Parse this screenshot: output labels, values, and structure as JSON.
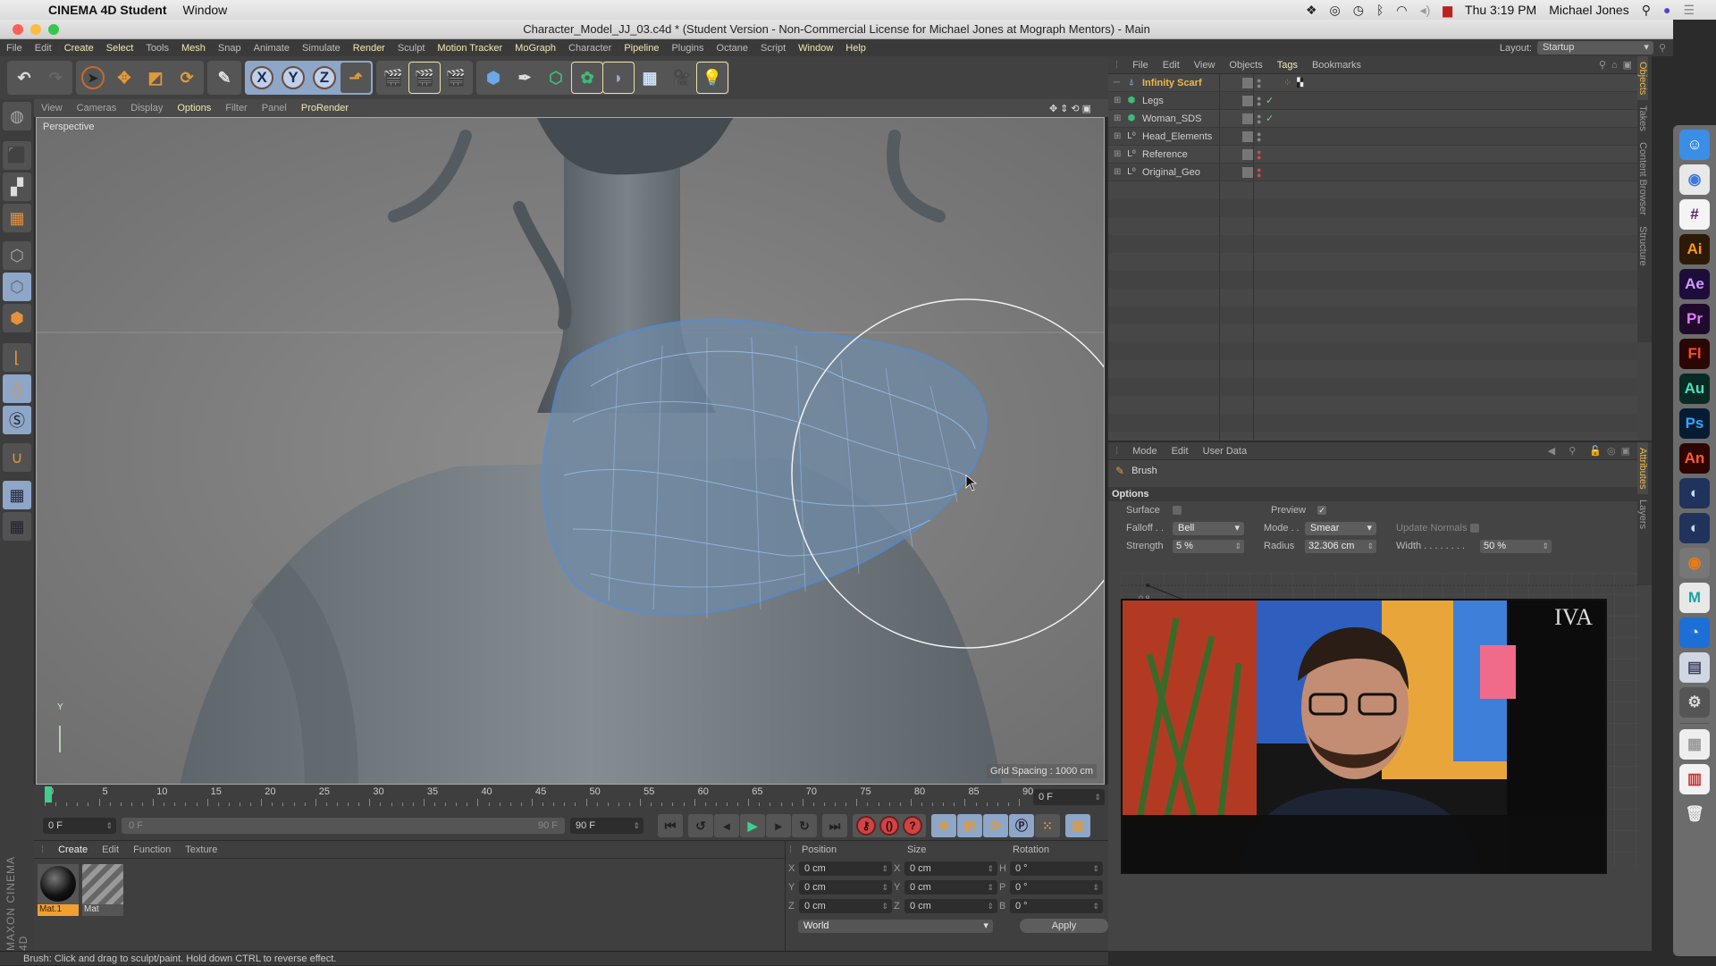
{
  "mac_menubar": {
    "app_name": "CINEMA 4D Student",
    "menu_window": "Window",
    "status_icons": [
      "dropbox-icon",
      "creative-cloud-icon",
      "time-machine-icon",
      "bluetooth-icon",
      "wifi-icon",
      "volume-icon",
      "flag-icon"
    ],
    "clock": "Thu 3:19 PM",
    "user": "Michael Jones"
  },
  "window": {
    "title": "Character_Model_JJ_03.c4d * (Student Version - Non-Commercial License for Michael Jones at Mograph Mentors) - Main"
  },
  "app_menu": {
    "items": [
      {
        "label": "File",
        "highlight": false
      },
      {
        "label": "Edit",
        "highlight": false
      },
      {
        "label": "Create",
        "highlight": true
      },
      {
        "label": "Select",
        "highlight": true
      },
      {
        "label": "Tools",
        "highlight": false
      },
      {
        "label": "Mesh",
        "highlight": true
      },
      {
        "label": "Snap",
        "highlight": false
      },
      {
        "label": "Animate",
        "highlight": false
      },
      {
        "label": "Simulate",
        "highlight": false
      },
      {
        "label": "Render",
        "highlight": true
      },
      {
        "label": "Sculpt",
        "highlight": false
      },
      {
        "label": "Motion Tracker",
        "highlight": true
      },
      {
        "label": "MoGraph",
        "highlight": true
      },
      {
        "label": "Character",
        "highlight": false
      },
      {
        "label": "Pipeline",
        "highlight": true
      },
      {
        "label": "Plugins",
        "highlight": false
      },
      {
        "label": "Octane",
        "highlight": false
      },
      {
        "label": "Script",
        "highlight": false
      },
      {
        "label": "Window",
        "highlight": true
      },
      {
        "label": "Help",
        "highlight": true
      }
    ],
    "layout_label": "Layout:",
    "layout_value": "Startup"
  },
  "toolbar": {
    "axis_x": "X",
    "axis_y": "Y",
    "axis_z": "Z"
  },
  "viewport": {
    "menu": [
      {
        "label": "View",
        "highlight": false
      },
      {
        "label": "Cameras",
        "highlight": false
      },
      {
        "label": "Display",
        "highlight": false
      },
      {
        "label": "Options",
        "highlight": true
      },
      {
        "label": "Filter",
        "highlight": false
      },
      {
        "label": "Panel",
        "highlight": false
      },
      {
        "label": "ProRender",
        "highlight": true
      }
    ],
    "camera_label": "Perspective",
    "grid_spacing": "Grid Spacing : 1000 cm",
    "axis_y": "Y"
  },
  "timeline": {
    "ticks": [
      "0",
      "5",
      "10",
      "15",
      "20",
      "25",
      "30",
      "35",
      "40",
      "45",
      "50",
      "55",
      "60",
      "65",
      "70",
      "75",
      "80",
      "85",
      "90"
    ],
    "current_frame_field": "0 F",
    "start_field": "0 F",
    "range_start": "0 F",
    "range_end": "90 F",
    "end_field": "90 F"
  },
  "material_manager": {
    "menu": [
      {
        "label": "Create",
        "highlight": true
      },
      {
        "label": "Edit",
        "highlight": false
      },
      {
        "label": "Function",
        "highlight": false
      },
      {
        "label": "Texture",
        "highlight": false
      }
    ],
    "materials": [
      {
        "name": "Mat.1",
        "selected": true
      },
      {
        "name": "Mat",
        "selected": false
      }
    ],
    "brand": "MAXON CINEMA 4D"
  },
  "coordinates": {
    "headers": {
      "position": "Position",
      "size": "Size",
      "rotation": "Rotation"
    },
    "rows": [
      {
        "p_axis": "X",
        "p_val": "0 cm",
        "s_axis": "X",
        "s_val": "0 cm",
        "r_axis": "H",
        "r_val": "0 °"
      },
      {
        "p_axis": "Y",
        "p_val": "0 cm",
        "s_axis": "Y",
        "s_val": "0 cm",
        "r_axis": "P",
        "r_val": "0 °"
      },
      {
        "p_axis": "Z",
        "p_val": "0 cm",
        "s_axis": "Z",
        "s_val": "0 cm",
        "r_axis": "B",
        "r_val": "0 °"
      }
    ],
    "space": "World",
    "apply": "Apply"
  },
  "status_bar": "Brush: Click and drag to sculpt/paint. Hold down CTRL to reverse effect.",
  "object_manager": {
    "menu": [
      {
        "label": "File",
        "highlight": false
      },
      {
        "label": "Edit",
        "highlight": false
      },
      {
        "label": "View",
        "highlight": false
      },
      {
        "label": "Objects",
        "highlight": false
      },
      {
        "label": "Tags",
        "highlight": true
      },
      {
        "label": "Bookmarks",
        "highlight": false
      }
    ],
    "objects": [
      {
        "name": "Infinity Scarf",
        "icon": "sculpt-icon",
        "expandable": false,
        "selected": true,
        "check": false,
        "dot_color": "#888888"
      },
      {
        "name": "Legs",
        "icon": "subdivision-icon",
        "expandable": true,
        "selected": false,
        "check": true,
        "dot_color": "#888888"
      },
      {
        "name": "Woman_SDS",
        "icon": "subdivision-icon",
        "expandable": true,
        "selected": false,
        "check": true,
        "dot_color": "#888888"
      },
      {
        "name": "Head_Elements",
        "icon": "null-icon",
        "expandable": true,
        "selected": false,
        "check": false,
        "dot_color": "#888888"
      },
      {
        "name": "Reference",
        "icon": "null-icon",
        "expandable": true,
        "selected": false,
        "check": false,
        "dot_color": "#d04a4a"
      },
      {
        "name": "Original_Geo",
        "icon": "null-icon",
        "expandable": true,
        "selected": false,
        "check": false,
        "dot_color": "#d04a4a"
      }
    ],
    "side_tabs": [
      {
        "label": "Objects",
        "active": true
      },
      {
        "label": "Takes",
        "active": false
      },
      {
        "label": "Content Browser",
        "active": false
      },
      {
        "label": "Structure",
        "active": false
      }
    ]
  },
  "attributes": {
    "menu": [
      {
        "label": "Mode"
      },
      {
        "label": "Edit"
      },
      {
        "label": "User Data"
      }
    ],
    "tool_name": "Brush",
    "section": "Options",
    "surface_label": "Surface",
    "surface_checked": false,
    "preview_label": "Preview",
    "preview_checked": true,
    "falloff_label": "Falloff . .",
    "falloff_value": "Bell",
    "mode_label": "Mode . .",
    "mode_value": "Smear",
    "update_normals_label": "Update Normals",
    "strength_label": "Strength",
    "strength_value": "5 %",
    "radius_label": "Radius",
    "radius_value": "32.306 cm",
    "width_label": "Width . . . . . . . .",
    "width_value": "50 %",
    "curve_label": "0.8",
    "side_tabs": [
      {
        "label": "Attributes",
        "active": true
      },
      {
        "label": "Layers",
        "active": false
      }
    ]
  },
  "video_overlay": {
    "sign_text": "IVA"
  },
  "dock": {
    "apps": [
      {
        "name": "Finder",
        "glyph": "☺",
        "bg": "#3a8ee6",
        "fg": "#fff"
      },
      {
        "name": "Chrome",
        "glyph": "◉",
        "bg": "#e8e8e8",
        "fg": "#3b7be0"
      },
      {
        "name": "Slack",
        "glyph": "#",
        "bg": "#f4f4f4",
        "fg": "#611f69"
      },
      {
        "name": "Illustrator",
        "glyph": "Ai",
        "bg": "#2d1a06",
        "fg": "#ff9a00"
      },
      {
        "name": "After Effects",
        "glyph": "Ae",
        "bg": "#1d0d3b",
        "fg": "#d39bff"
      },
      {
        "name": "Premiere",
        "glyph": "Pr",
        "bg": "#1f0a2c",
        "fg": "#e07cff"
      },
      {
        "name": "Flash",
        "glyph": "Fl",
        "bg": "#2a0703",
        "fg": "#ff4a2a"
      },
      {
        "name": "Audition",
        "glyph": "Au",
        "bg": "#0a2a24",
        "fg": "#4de0c0"
      },
      {
        "name": "Photoshop",
        "glyph": "Ps",
        "bg": "#061c33",
        "fg": "#31a8ff"
      },
      {
        "name": "Animate",
        "glyph": "An",
        "bg": "#2d0603",
        "fg": "#ff5a3a"
      },
      {
        "name": "Cinema 4D",
        "glyph": "◐",
        "bg": "#20335c",
        "fg": "#c9d9ff"
      },
      {
        "name": "Cinema 4D 2",
        "glyph": "◐",
        "bg": "#20335c",
        "fg": "#c9d9ff"
      },
      {
        "name": "Blender",
        "glyph": "◉",
        "bg": "#777",
        "fg": "#f07a10"
      },
      {
        "name": "Maya",
        "glyph": "M",
        "bg": "#e8e8e8",
        "fg": "#1aa3a3"
      },
      {
        "name": "QuickTime",
        "glyph": "◔",
        "bg": "#1d6fd6",
        "fg": "#dfefff"
      },
      {
        "name": "Preview",
        "glyph": "▤",
        "bg": "#cfd7e2",
        "fg": "#446"
      },
      {
        "name": "System Preferences",
        "glyph": "⚙",
        "bg": "#555",
        "fg": "#ddd"
      },
      {
        "name": "Documents",
        "glyph": "▦",
        "bg": "#eee",
        "fg": "#999"
      },
      {
        "name": "Downloads",
        "glyph": "▥",
        "bg": "#f2f2f2",
        "fg": "#c33"
      },
      {
        "name": "Trash",
        "glyph": "🗑",
        "bg": "transparent",
        "fg": "#eee"
      }
    ]
  }
}
